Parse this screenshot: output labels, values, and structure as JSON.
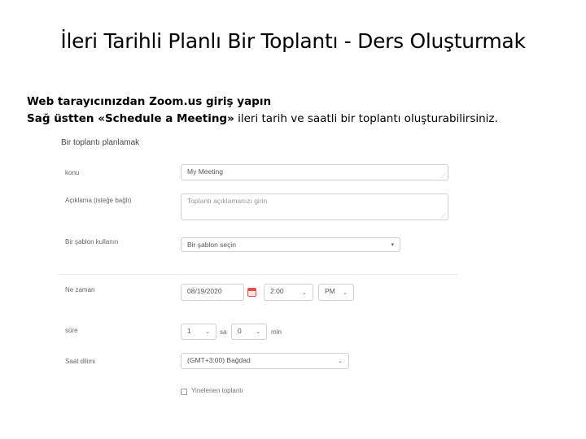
{
  "slide": {
    "title": "İleri Tarihli Planlı Bir Toplantı - Ders Oluşturmak",
    "intro_line1": "Web tarayıcınızdan Zoom.us giriş yapın",
    "intro_line2_prefix": "Sağ üstten  ",
    "intro_line2_bold": "«Schedule a Meeting»",
    "intro_line2_suffix": " ileri tarih ve saatli bir toplantı oluşturabilirsiniz."
  },
  "form": {
    "heading": "Bir toplantı planlamak",
    "topic": {
      "label": "konu",
      "value": "My Meeting"
    },
    "description": {
      "label": "Açıklama (isteğe bağlı)",
      "placeholder": "Toplantı açıklamanızı girin"
    },
    "template": {
      "label": "Bir şablon kullanın",
      "value": "Bir şablon seçin"
    },
    "when": {
      "label": "Ne zaman",
      "date": "08/19/2020",
      "time": "2:00",
      "ampm": "PM"
    },
    "duration": {
      "label": "süre",
      "hours": "1",
      "hours_unit": "sa",
      "minutes": "0",
      "minutes_unit": "min"
    },
    "timezone": {
      "label": "Saat dilimi",
      "value": "(GMT+3:00) Bağdad"
    },
    "recurring": {
      "label": "Yinelenen toplantı",
      "checked": false
    }
  },
  "icons": {
    "dropdown": "chevron-down-icon",
    "calendar": "calendar-icon",
    "resize": "resize-handle-icon"
  }
}
